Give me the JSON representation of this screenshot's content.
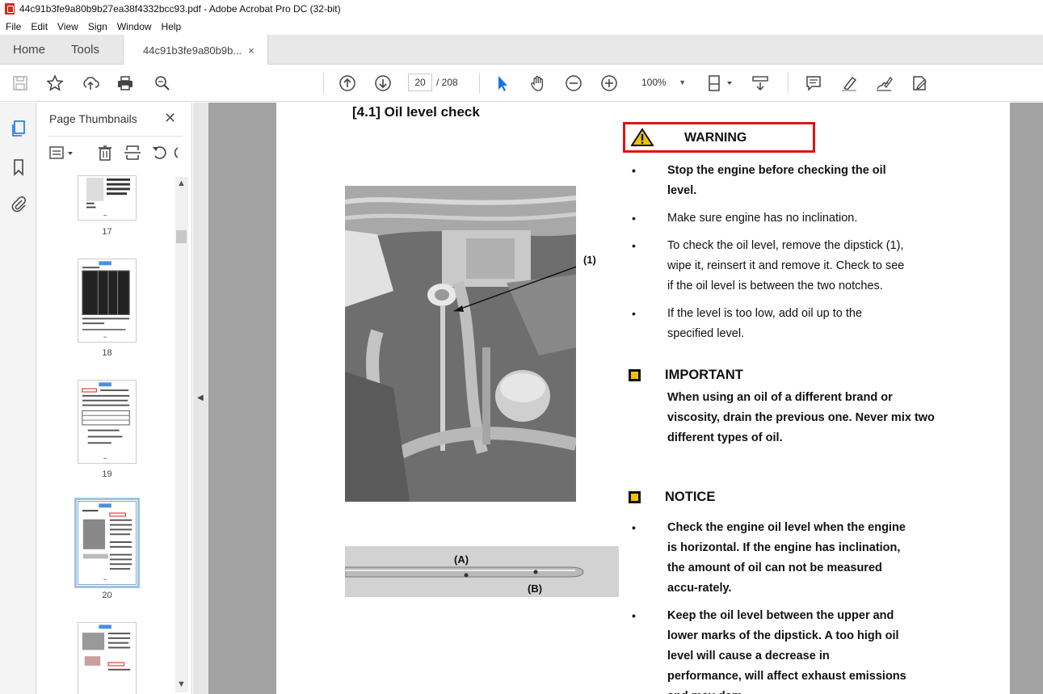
{
  "window": {
    "title": "44c91b3fe9a80b9b27ea38f4332bcc93.pdf - Adobe Acrobat Pro DC (32-bit)"
  },
  "menu": [
    "File",
    "Edit",
    "View",
    "Sign",
    "Window",
    "Help"
  ],
  "tabs": {
    "home": "Home",
    "tools": "Tools",
    "doc": "44c91b3fe9a80b9b...",
    "close": "×"
  },
  "toolbar": {
    "page_current": "20",
    "page_total": "/ 208",
    "zoom": "100%"
  },
  "panel": {
    "title": "Page Thumbnails",
    "close": "✕",
    "thumbnails": [
      {
        "label": "17"
      },
      {
        "label": "18"
      },
      {
        "label": "19"
      },
      {
        "label": "20",
        "selected": true
      },
      {
        "label": ""
      }
    ]
  },
  "page": {
    "heading": "[4.1] Oil level check",
    "callout_label": "(1)",
    "dipstick_label_a": "(A)",
    "dipstick_label_b": "(B)",
    "warning": {
      "title": "WARNING",
      "items": [
        {
          "text": "Stop the engine before checking the oil level.",
          "bold": true
        },
        {
          "text": "Make sure engine has no inclination.",
          "bold": false
        },
        {
          "text": "To check the oil level, remove the dipstick (1), wipe it, reinsert it and remove it. Check to see if the oil level is between the two notches.",
          "bold": false
        },
        {
          "text": "If the level is too low, add oil up to the specified level.",
          "bold": false
        }
      ]
    },
    "important": {
      "title": "IMPORTANT",
      "body": "When using an oil of a different  brand or viscosity, drain the previous one. Never mix two different types of oil."
    },
    "notice": {
      "title": "NOTICE",
      "items": [
        "Check the engine oil level when the engine is horizontal. If the engine has inclination, the amount of oil can not be measured accu-rately.",
        "Keep the oil level between the upper and lower marks of the dipstick. A too high oil level will cause a decrease in performance, will affect exhaust emissions and may dam-"
      ]
    }
  },
  "icons": {
    "rail": [
      "pages-icon",
      "bookmark-icon",
      "attachment-icon"
    ],
    "toolbar": [
      "save-icon",
      "star-icon",
      "upload-icon",
      "print-icon",
      "search-icon",
      "prev-page-icon",
      "next-page-icon",
      "select-cursor-icon",
      "hand-icon",
      "zoom-out-icon",
      "zoom-in-icon",
      "page-fit-icon",
      "scroll-mode-icon",
      "comment-icon",
      "highlight-icon",
      "sign-icon",
      "fill-sign-icon"
    ]
  },
  "colors": {
    "warning_border": "#e01414",
    "note_square": "#f2c200",
    "selected_thumb": "#9fc3e4"
  }
}
